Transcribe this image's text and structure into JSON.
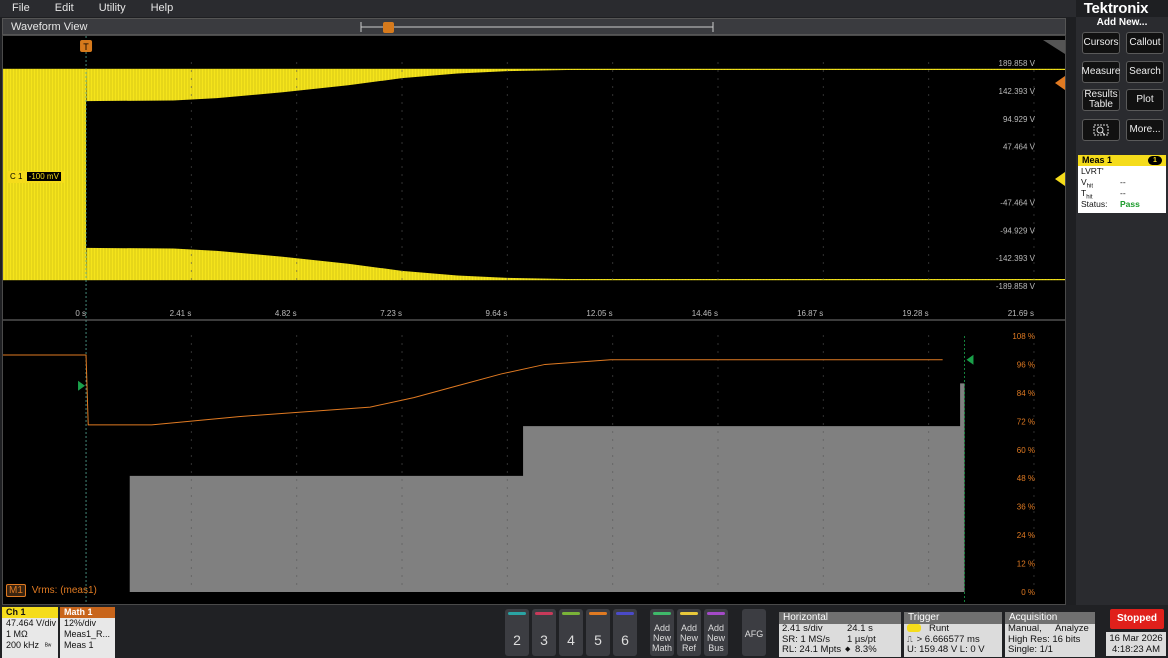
{
  "menu": [
    "File",
    "Edit",
    "Utility",
    "Help"
  ],
  "brand": "Tektronix",
  "waveform_view": {
    "title": "Waveform View",
    "ch1_label": "C 1",
    "ch1_offset": "-100 mV",
    "m1_tag": "M1",
    "m1_expr": "Vrms: (meas1)"
  },
  "chart_data": [
    {
      "type": "line",
      "series": [
        {
          "name": "C 1"
        }
      ],
      "y_tick_labels": [
        "189.858 V",
        "142.393 V",
        "94.929 V",
        "47.464 V",
        "-47.464 V",
        "-94.929 V",
        "-142.393 V",
        "-189.858 V"
      ],
      "x_tick_labels": [
        "0 s",
        "2.41 s",
        "4.82 s",
        "7.23 s",
        "9.64 s",
        "12.05 s",
        "14.46 s",
        "16.87 s",
        "19.28 s",
        "21.69 s"
      ],
      "ylim": [
        -189.858,
        189.858
      ],
      "xlim": [
        -1.9,
        22.4
      ],
      "envelope_positive": {
        "x": [
          -1.9,
          0,
          0.01,
          2,
          3,
          4.5,
          6,
          7.23,
          8.5,
          9.64,
          11,
          12,
          22.4
        ],
        "y": [
          180,
          180,
          125,
          126,
          130,
          140,
          152,
          164,
          172,
          176,
          178,
          178,
          178
        ]
      },
      "envelope_negative": {
        "x": [
          -1.9,
          0,
          0.01,
          2,
          3,
          4.5,
          6,
          7.23,
          8.5,
          9.64,
          11,
          12,
          22.4
        ],
        "y": [
          -180,
          -180,
          -125,
          -126,
          -130,
          -140,
          -152,
          -164,
          -172,
          -176,
          -178,
          -178,
          -178
        ]
      }
    },
    {
      "type": "line",
      "y_tick_labels": [
        "108 %",
        "96 %",
        "84 %",
        "72 %",
        "60 %",
        "48 %",
        "36 %",
        "24 %",
        "12 %",
        "0 %"
      ],
      "ylim": [
        0,
        108
      ],
      "xlim": [
        -1.9,
        22.4
      ],
      "vrms_pct": {
        "x": [
          -1.9,
          0,
          0.05,
          1.5,
          3.5,
          6.5,
          7.5,
          8.5,
          9.5,
          10.5,
          12,
          19.6
        ],
        "y": [
          100,
          100,
          70.5,
          70.5,
          74,
          78,
          82,
          87,
          92,
          96,
          98,
          98
        ]
      },
      "limit_mask": {
        "x": [
          1,
          1,
          10,
          10,
          20,
          20,
          20.1,
          20.1
        ],
        "y": [
          0,
          49,
          49,
          70,
          70,
          88,
          88,
          0
        ]
      }
    }
  ],
  "right_panel": {
    "add_new": "Add New...",
    "cursors": "Cursors",
    "callout": "Callout",
    "measure": "Measure",
    "search": "Search",
    "results_l1": "Results",
    "results_l2": "Table",
    "plot": "Plot",
    "more": "More...",
    "meas_title": "Meas 1",
    "meas_num": "1",
    "meas_name": "LVRT'",
    "vhit_label": "V",
    "vhit_sub": "hit",
    "vhit_value": "--",
    "thit_label": "T",
    "thit_sub": "hit",
    "thit_value": "--",
    "status_label": "Status:",
    "status_value": "Pass"
  },
  "ch1_badge": {
    "title": "Ch 1",
    "scale": "47.464 V/div",
    "imp": "1 MΩ",
    "bw": "200 kHz"
  },
  "math1_badge": {
    "title": "Math 1",
    "scale": "12%/div",
    "src": "Meas1_R...",
    "meas": "Meas 1"
  },
  "channels": [
    "2",
    "3",
    "4",
    "5",
    "6"
  ],
  "add_buttons": [
    {
      "l1": "Add",
      "l2": "New",
      "l3": "Math"
    },
    {
      "l1": "Add",
      "l2": "New",
      "l3": "Ref"
    },
    {
      "l1": "Add",
      "l2": "New",
      "l3": "Bus"
    }
  ],
  "afg": "AFG",
  "horizontal": {
    "title": "Horizontal",
    "sdiv": "2.41 s/div",
    "span": "24.1 s",
    "sr": "SR: 1 MS/s",
    "pt": "1 µs/pt",
    "rl": "RL: 24.1 Mpts",
    "pos": "8.3%"
  },
  "trigger": {
    "title": "Trigger",
    "mode": "Runt",
    "cond": "> 6.666577 ms",
    "levels": "U: 159.48 V  L: 0 V"
  },
  "acquisition": {
    "title": "Acquisition",
    "mode": "Manual,",
    "analyze": "Analyze",
    "res": "High Res: 16 bits",
    "single": "Single: 1/1"
  },
  "status": {
    "stopped": "Stopped",
    "date": "16 Mar 2026",
    "time": "4:18:23 AM"
  }
}
